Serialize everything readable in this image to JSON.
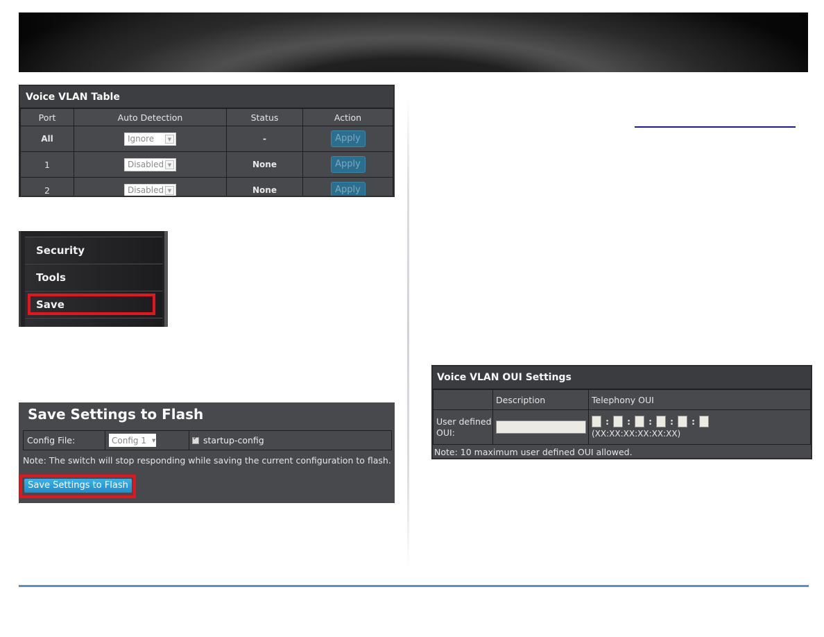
{
  "voice_vlan_table": {
    "title": "Voice VLAN Table",
    "columns": [
      "Port",
      "Auto Detection",
      "Status",
      "Action"
    ],
    "rows": [
      {
        "port": "All",
        "auto_detection": "Ignore",
        "status": "-",
        "action": "Apply"
      },
      {
        "port": "1",
        "auto_detection": "Disabled",
        "status": "None",
        "action": "Apply"
      },
      {
        "port": "2",
        "auto_detection": "Disabled",
        "status": "None",
        "action": "Apply"
      }
    ]
  },
  "side_menu": {
    "items": [
      {
        "label": "Security"
      },
      {
        "label": "Tools"
      },
      {
        "label": "Save",
        "highlighted": true
      }
    ],
    "highlight_color": "#e8141c"
  },
  "save_settings": {
    "title": "Save Settings to Flash",
    "config_file_label": "Config File:",
    "config_file_value": "Config 1",
    "startup_config_label": "startup-config",
    "startup_config_checked": true,
    "note": "Note: The switch will stop responding while saving the current configuration to flash.",
    "button_label": "Save Settings to Flash"
  },
  "oui_settings": {
    "title": "Voice VLAN OUI Settings",
    "columns": [
      "",
      "Description",
      "Telephony OUI"
    ],
    "row_label": "User defined OUI:",
    "description_value": "",
    "oui_octets": [
      "",
      "",
      "",
      "",
      "",
      ""
    ],
    "oui_separator": ":",
    "oui_format": "(XX:XX:XX:XX:XX:XX)",
    "note": "Note: 10 maximum user defined OUI allowed."
  },
  "colors": {
    "panel_bg": "#48494d",
    "apply_button": "#2a6f90",
    "save_flash_button": "#1f8ccc",
    "footer_line": "#5b8fc4",
    "link_underline": "#1a1aa0"
  }
}
